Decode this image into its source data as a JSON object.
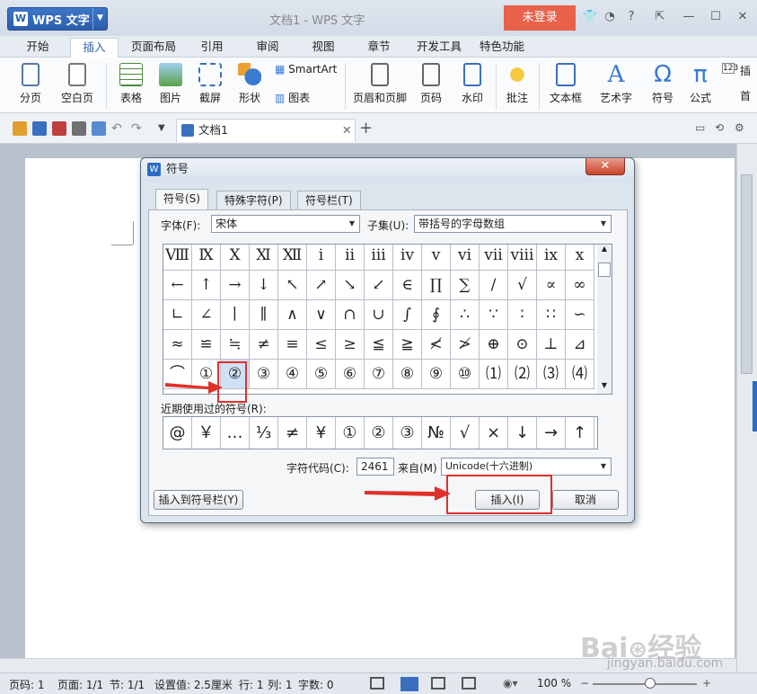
{
  "app": {
    "name": "WPS 文字",
    "doc_title": "文档1 - WPS 文字",
    "login": "未登录"
  },
  "menu_tabs": [
    "开始",
    "插入",
    "页面布局",
    "引用",
    "审阅",
    "视图",
    "章节",
    "开发工具",
    "特色功能"
  ],
  "active_tab": "插入",
  "ribbon": {
    "page_break": "分页",
    "blank_page": "空白页",
    "table": "表格",
    "picture": "图片",
    "screenshot": "截屏",
    "shape": "形状",
    "smartart": "SmartArt",
    "chart": "图表",
    "header_footer": "页眉和页脚",
    "page_number": "页码",
    "watermark": "水印",
    "comment": "批注",
    "textbox": "文本框",
    "wordart": "艺术字",
    "symbol": "符号",
    "formula": "公式",
    "more1": "插",
    "more2": "首"
  },
  "document_tab": {
    "label": "文档1"
  },
  "dialog": {
    "title": "符号",
    "tabs": [
      "符号(S)",
      "特殊字符(P)",
      "符号栏(T)"
    ],
    "font_label": "字体(F):",
    "font_value": "宋体",
    "subset_label": "子集(U):",
    "subset_value": "带括号的字母数组",
    "grid": [
      [
        "Ⅷ",
        "Ⅸ",
        "Ⅹ",
        "Ⅺ",
        "Ⅻ",
        "ⅰ",
        "ⅱ",
        "ⅲ",
        "ⅳ",
        "ⅴ",
        "ⅵ",
        "ⅶ",
        "ⅷ",
        "ⅸ",
        "ⅹ"
      ],
      [
        "←",
        "↑",
        "→",
        "↓",
        "↖",
        "↗",
        "↘",
        "↙",
        "∈",
        "∏",
        "∑",
        "∕",
        "√",
        "∝",
        "∞"
      ],
      [
        "∟",
        "∠",
        "∣",
        "∥",
        "∧",
        "∨",
        "∩",
        "∪",
        "∫",
        "∮",
        "∴",
        "∵",
        "∶",
        "∷",
        "∽"
      ],
      [
        "≈",
        "≌",
        "≒",
        "≠",
        "≡",
        "≤",
        "≥",
        "≦",
        "≧",
        "≮",
        "≯",
        "⊕",
        "⊙",
        "⊥",
        "⊿"
      ],
      [
        "⌒",
        "①",
        "②",
        "③",
        "④",
        "⑤",
        "⑥",
        "⑦",
        "⑧",
        "⑨",
        "⑩",
        "⑴",
        "⑵",
        "⑶",
        "⑷"
      ]
    ],
    "recent_label": "近期使用过的符号(R):",
    "recent": [
      "@",
      "￥",
      "…",
      "⅓",
      "≠",
      "¥",
      "①",
      "②",
      "③",
      "№",
      "√",
      "×",
      "↓",
      "→",
      "↑"
    ],
    "char_code_label": "字符代码(C):",
    "char_code": "2461",
    "from_label": "来自(M)",
    "from_value": "Unicode(十六进制)",
    "insert_to_bar": "插入到符号栏(Y)",
    "insert": "插入(I)",
    "cancel": "取消"
  },
  "status": {
    "page": "页码: 1",
    "pages": "页面: 1/1",
    "section": "节: 1/1",
    "setting": "设置值: 2.5厘米",
    "row": "行: 1",
    "col": "列: 1",
    "words": "字数: 0",
    "zoom": "100 %"
  },
  "watermark_text": "jingyan.baidu.com",
  "colors": {
    "accent": "#2b5fad",
    "login": "#e8614a",
    "highlight": "#e0302a"
  }
}
